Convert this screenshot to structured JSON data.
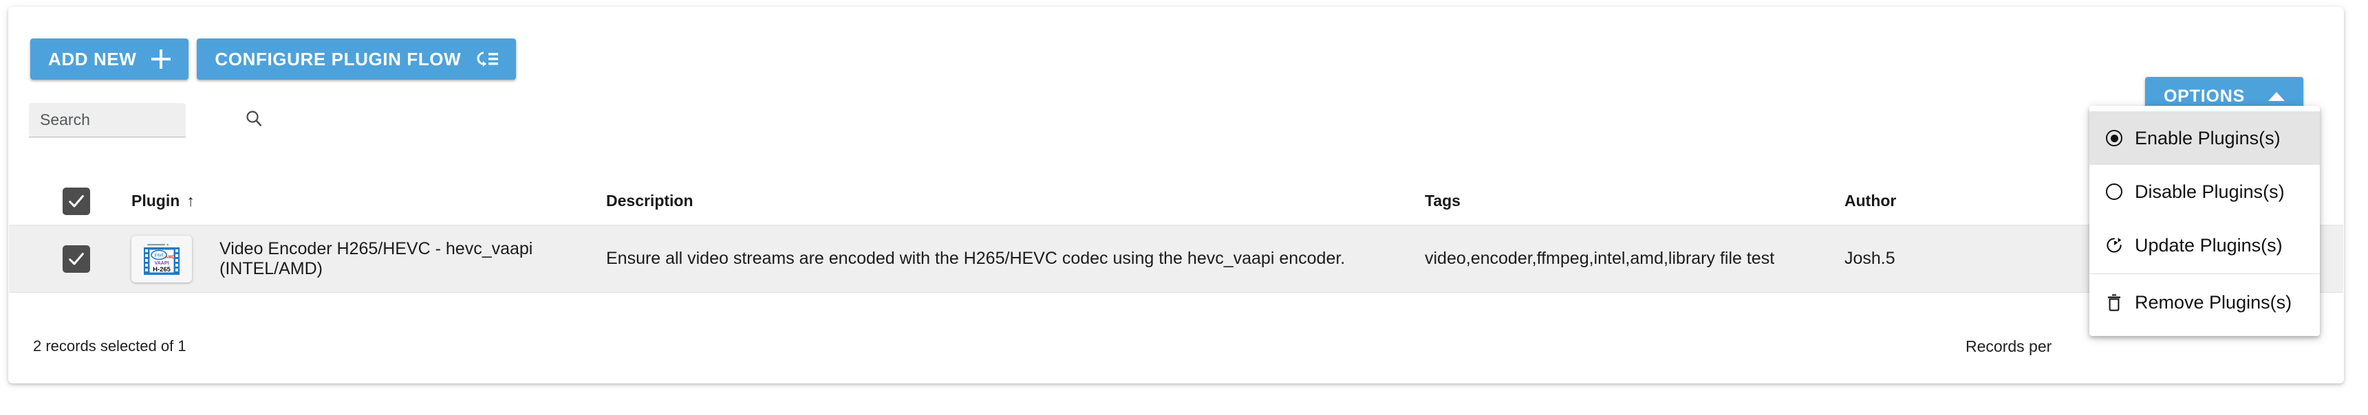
{
  "toolbar": {
    "add_new_label": "ADD NEW",
    "configure_label": "CONFIGURE PLUGIN FLOW"
  },
  "search": {
    "placeholder": "Search",
    "value": ""
  },
  "table": {
    "columns": [
      {
        "key": "select",
        "label": ""
      },
      {
        "key": "plugin",
        "label": "Plugin",
        "sort": "↑"
      },
      {
        "key": "description",
        "label": "Description"
      },
      {
        "key": "tags",
        "label": "Tags"
      },
      {
        "key": "author",
        "label": "Author"
      }
    ],
    "rows": [
      {
        "selected": true,
        "plugin": "Video Encoder H265/HEVC - hevc_vaapi (INTEL/AMD)",
        "description": "Ensure all video streams are encoded with the H265/HEVC codec using the hevc_vaapi encoder.",
        "tags": "video,encoder,ffmpeg,intel,amd,library file test",
        "author": "Josh.5",
        "icon_lines": [
          "intel",
          "AMD",
          "VAAPI",
          "H-265"
        ]
      }
    ]
  },
  "footer": {
    "records_selected": "2 records selected of 1",
    "records_per_page_label": "Records per"
  },
  "options": {
    "button_label": "OPTIONS",
    "menu": [
      {
        "label": "Enable Plugins(s)",
        "icon": "radio-on-icon",
        "active": true,
        "divider_before": false
      },
      {
        "label": "Disable Plugins(s)",
        "icon": "radio-off-icon",
        "active": false,
        "divider_before": false
      },
      {
        "label": "Update Plugins(s)",
        "icon": "update-icon",
        "active": false,
        "divider_before": false
      },
      {
        "label": "Remove Plugins(s)",
        "icon": "trash-icon",
        "active": false,
        "divider_before": true
      }
    ]
  },
  "colors": {
    "accent_blue": "#4da2db",
    "row_selected_bg": "#efefef",
    "menu_active_bg": "#e4e4e4",
    "checkbox_bg": "#4d4d4d"
  }
}
